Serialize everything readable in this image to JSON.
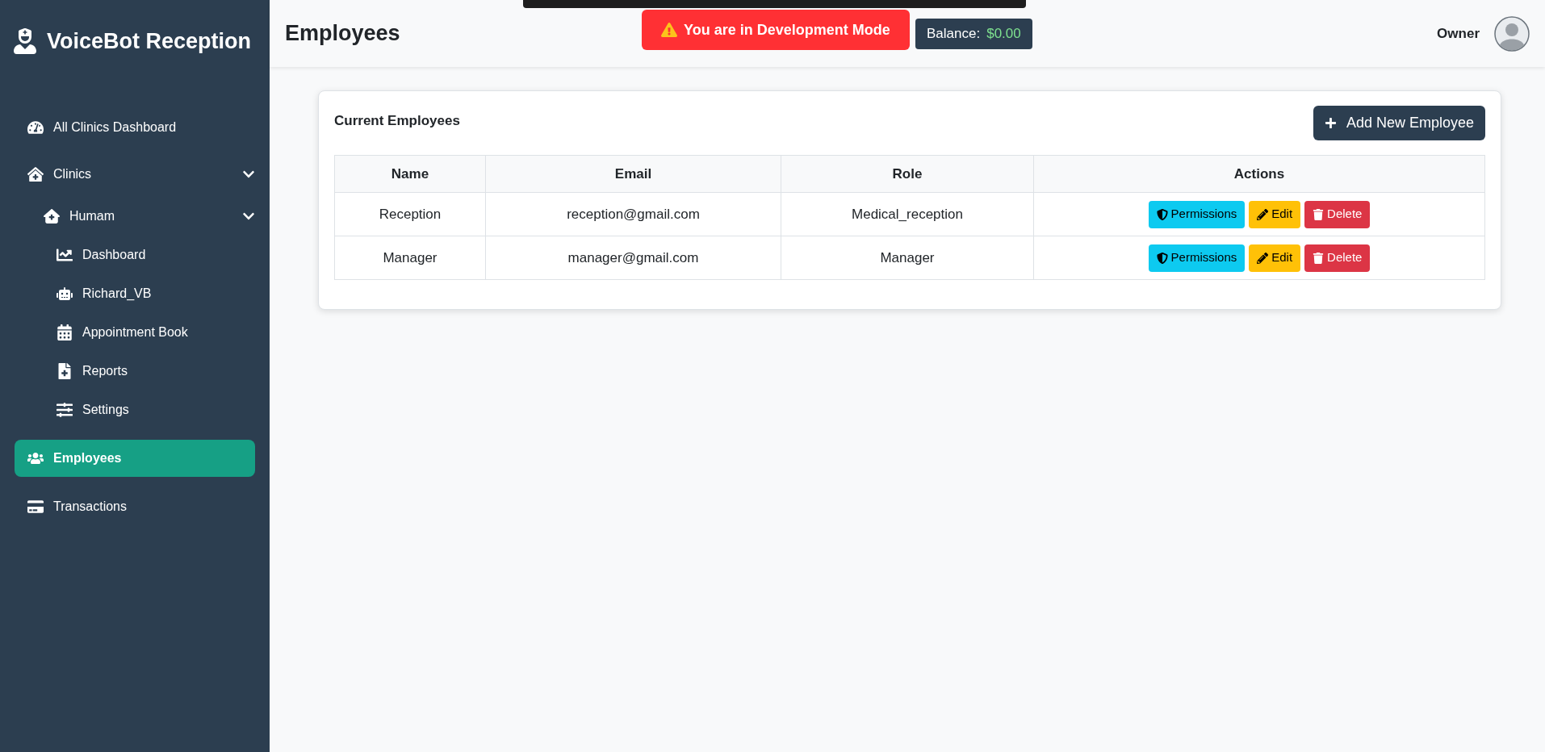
{
  "sidebar": {
    "brand": "VoiceBot Reception",
    "items": [
      {
        "label": "All Clinics Dashboard",
        "selected": false
      },
      {
        "label": "Clinics",
        "selected": false,
        "expanded": true,
        "children": [
          {
            "label": "Humam",
            "selected": false,
            "expanded": true,
            "children": [
              {
                "label": "Dashboard",
                "selected": false
              },
              {
                "label": "Richard_VB",
                "selected": false
              },
              {
                "label": "Appointment Book",
                "selected": false
              },
              {
                "label": "Reports",
                "selected": false
              },
              {
                "label": "Settings",
                "selected": false
              }
            ]
          }
        ]
      },
      {
        "label": "Employees",
        "selected": true
      },
      {
        "label": "Transactions",
        "selected": false
      }
    ]
  },
  "header": {
    "title": "Employees",
    "balance_label": "Balance:",
    "balance_value": "$0.00",
    "user": "Owner"
  },
  "toast": {
    "text": "You are in Development Mode"
  },
  "card": {
    "title": "Current Employees",
    "add_button": "Add New Employee",
    "table": {
      "columns": [
        "Name",
        "Email",
        "Role",
        "Actions"
      ],
      "rows": [
        {
          "name": "Reception",
          "email": "reception@gmail.com",
          "role": "Medical_reception",
          "actions": [
            {
              "kind": "info",
              "label": "Permissions"
            },
            {
              "kind": "warning",
              "label": "Edit"
            },
            {
              "kind": "danger",
              "label": "Delete"
            }
          ]
        },
        {
          "name": "Manager",
          "email": "manager@gmail.com",
          "role": "Manager",
          "actions": [
            {
              "kind": "info",
              "label": "Permissions"
            },
            {
              "kind": "warning",
              "label": "Edit"
            },
            {
              "kind": "danger",
              "label": "Delete"
            }
          ]
        }
      ]
    }
  }
}
